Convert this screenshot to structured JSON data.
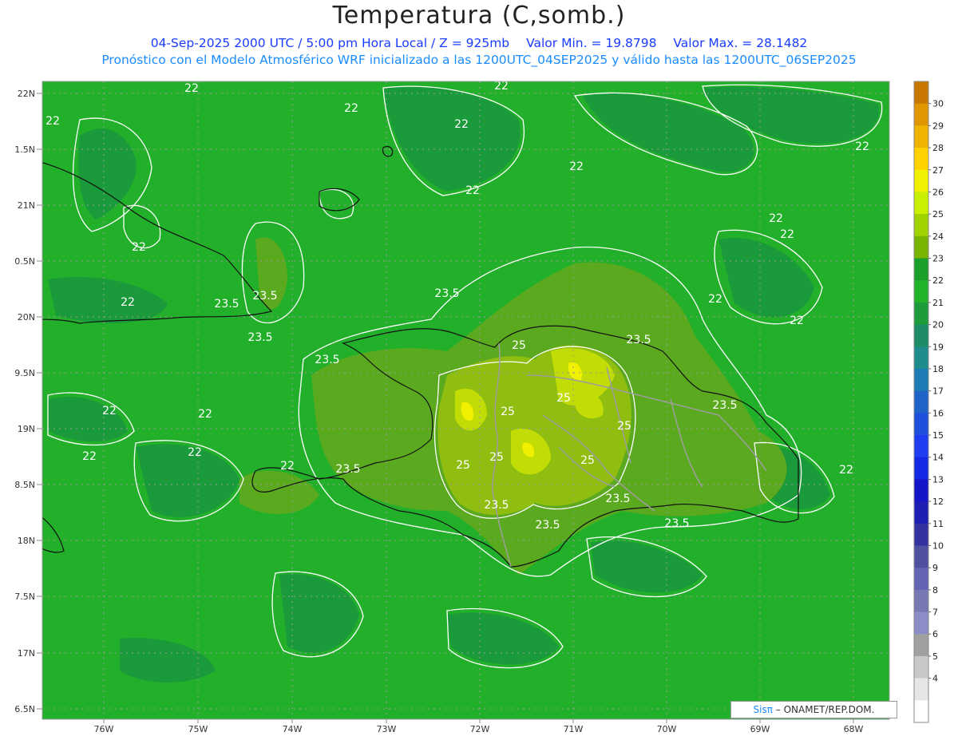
{
  "header": {
    "title": "Temperatura (C,somb.)",
    "info_datetime": "04-Sep-2025  2000 UTC / 5:00 pm Hora Local / Z = 925mb",
    "info_min": "Valor Min. = 19.8798",
    "info_max": "Valor Max. = 28.1482",
    "model_line": "Pronóstico con el Modelo Atmosférico WRF inicializado a las 1200UTC_04SEP2025 y válido hasta las  1200UTC_06SEP2025"
  },
  "map": {
    "lat_labels": [
      "22N",
      "1.5N",
      "21N",
      "0.5N",
      "20N",
      "9.5N",
      "19N",
      "8.5N",
      "18N",
      "7.5N",
      "17N",
      "6.5N"
    ],
    "lon_labels": [
      "76W",
      "75W",
      "74W",
      "73W",
      "72W",
      "71W",
      "70W",
      "69W",
      "68W"
    ],
    "contour_labels": [
      "22",
      "22",
      "22",
      "22",
      "22",
      "22",
      "22",
      "22",
      "22",
      "22",
      "22",
      "22",
      "22",
      "22",
      "22",
      "22",
      "22",
      "22",
      "22",
      "22",
      "23.5",
      "23.5",
      "23.5",
      "23.5",
      "23.5",
      "23.5",
      "23.5",
      "23.5",
      "23.5",
      "23.5",
      "23.5",
      "23.5",
      "25",
      "25",
      "25",
      "25",
      "25",
      "25",
      "25"
    ],
    "background_color": "#22b02a"
  },
  "colorbar": {
    "ticks": [
      "30",
      "29",
      "28",
      "27",
      "26",
      "25",
      "24",
      "23",
      "22",
      "21",
      "20",
      "19",
      "18",
      "17",
      "16",
      "15",
      "14",
      "13",
      "12",
      "11",
      "10",
      "9",
      "8",
      "7",
      "6",
      "5",
      "4"
    ],
    "colors": [
      "#c87800",
      "#e09600",
      "#f0b400",
      "#ffd200",
      "#f0f000",
      "#c8f000",
      "#a0d200",
      "#78b400",
      "#1aa028",
      "#21b42a",
      "#1e9c3c",
      "#1e8c64",
      "#1e8c8c",
      "#1e7cb4",
      "#1e64c8",
      "#1e50dc",
      "#1e3cf0",
      "#1428e6",
      "#1414c8",
      "#1e1eb4",
      "#3232a0",
      "#5050a0",
      "#6464b4",
      "#7878b4",
      "#8c8cc8",
      "#a0a0a0",
      "#c8c8c8",
      "#e6e6e6",
      "#ffffff"
    ]
  },
  "credit": {
    "brand": "Sisπ",
    "text": "– ONAMET/REP.DOM."
  }
}
